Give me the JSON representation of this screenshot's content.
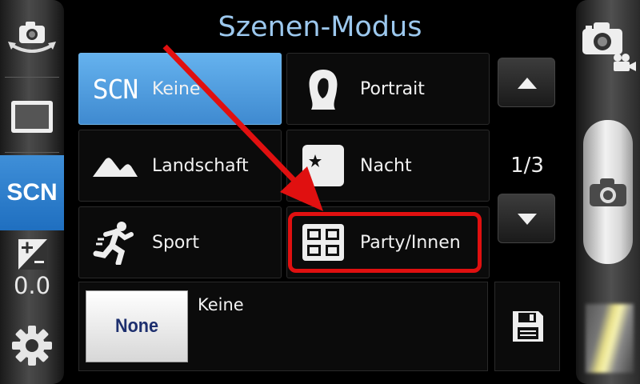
{
  "title": "Szenen-Modus",
  "left_sidebar": {
    "scene_mode_label": "SCN",
    "exposure_value": "0.0",
    "icons": [
      "camera-switch-icon",
      "aspect-ratio-icon",
      "exposure-icon",
      "settings-gear-icon"
    ]
  },
  "right_sidebar": {
    "icons": [
      "camera-mode-icon",
      "video-mode-icon",
      "shutter-camera-icon"
    ]
  },
  "scenes": [
    {
      "label": "Keine",
      "icon": "scn-icon",
      "selected": true
    },
    {
      "label": "Portrait",
      "icon": "portrait-icon",
      "selected": false
    },
    {
      "label": "Landschaft",
      "icon": "landscape-icon",
      "selected": false
    },
    {
      "label": "Nacht",
      "icon": "night-icon",
      "selected": false
    },
    {
      "label": "Sport",
      "icon": "sport-icon",
      "selected": false
    },
    {
      "label": "Party/Innen",
      "icon": "party-indoor-icon",
      "selected": false
    }
  ],
  "scn_icon_text": "SCN",
  "pagination": {
    "indicator": "1/3"
  },
  "preview": {
    "image_text": "None",
    "label": "Keine"
  },
  "colors": {
    "accent": "#3f8fd8",
    "title": "#9cc8ee",
    "annotation": "#e01010"
  }
}
